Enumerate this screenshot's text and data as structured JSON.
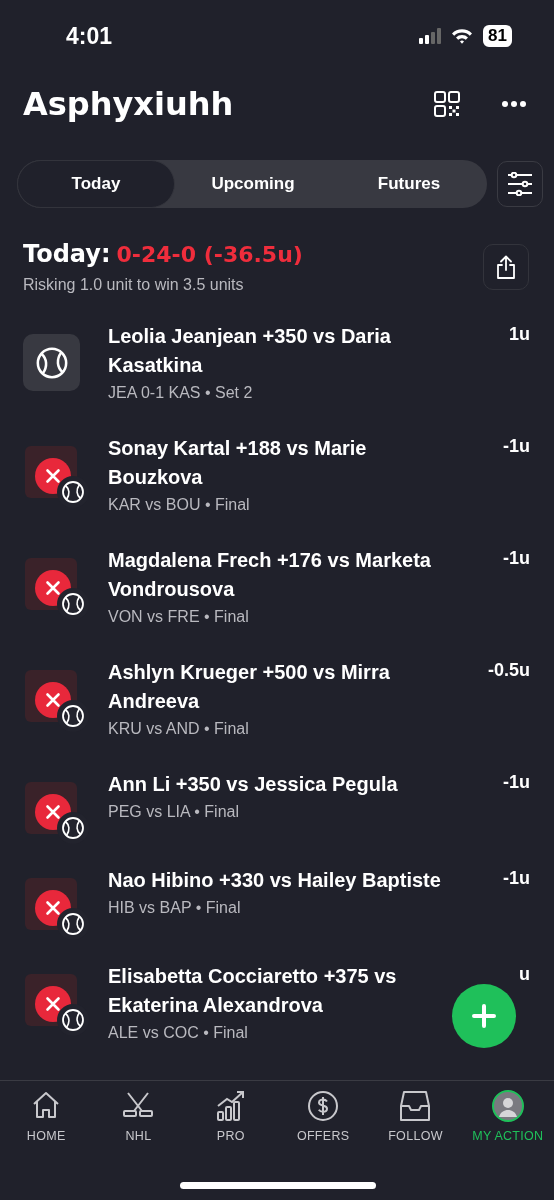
{
  "status_bar": {
    "time": "4:01",
    "battery": "81"
  },
  "header": {
    "title": "Asphyxiuhh"
  },
  "tabs": [
    {
      "label": "Today",
      "selected": true
    },
    {
      "label": "Upcoming",
      "selected": false
    },
    {
      "label": "Futures",
      "selected": false
    }
  ],
  "summary": {
    "label": "Today:",
    "record": "0-24-0 (-36.5u)",
    "subtitle": "Risking 1.0 unit to win 3.5 units"
  },
  "bets": [
    {
      "kind": "live",
      "title": "Leolia Jeanjean +350 vs Daria Kasatkina",
      "detail": "JEA 0-1 KAS • Set 2",
      "amount": "1u"
    },
    {
      "kind": "lost",
      "title": "Sonay Kartal +188 vs Marie Bouzkova",
      "detail": "KAR vs BOU • Final",
      "amount": "-1u"
    },
    {
      "kind": "lost",
      "title": "Magdalena Frech +176 vs Marketa Vondrousova",
      "detail": "VON vs FRE • Final",
      "amount": "-1u"
    },
    {
      "kind": "lost",
      "title": "Ashlyn Krueger +500 vs Mirra Andreeva",
      "detail": "KRU vs AND • Final",
      "amount": "-0.5u"
    },
    {
      "kind": "lost",
      "title": "Ann Li +350 vs Jessica Pegula",
      "detail": "PEG vs LIA • Final",
      "amount": "-1u"
    },
    {
      "kind": "lost",
      "title": "Nao Hibino +330 vs Hailey Baptiste",
      "detail": "HIB vs BAP • Final",
      "amount": "-1u"
    },
    {
      "kind": "lost",
      "title": "Elisabetta Cocciaretto +375 vs Ekaterina Alexandrova",
      "detail": "ALE vs COC • Final",
      "amount": "u"
    }
  ],
  "nav": [
    {
      "label": "HOME",
      "kind": "home",
      "selected": false
    },
    {
      "label": "NHL",
      "kind": "hockey",
      "selected": false
    },
    {
      "label": "PRO",
      "kind": "chart",
      "selected": false
    },
    {
      "label": "OFFERS",
      "kind": "dollar",
      "selected": false
    },
    {
      "label": "FOLLOW",
      "kind": "inbox",
      "selected": false
    },
    {
      "label": "MY ACTION",
      "kind": "avatar",
      "selected": true
    }
  ]
}
